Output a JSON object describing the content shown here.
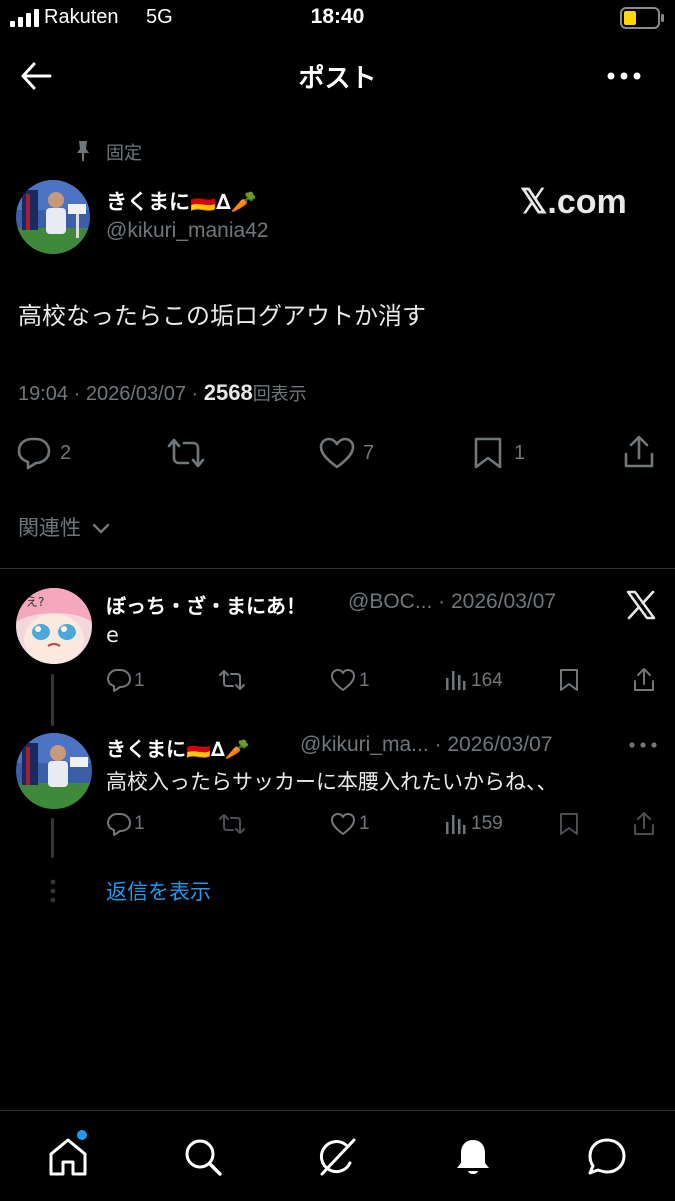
{
  "status_bar": {
    "carrier": "Rakuten",
    "network": "5G",
    "time": "18:40"
  },
  "header": {
    "title": "ポスト",
    "back_icon": "back-arrow-icon",
    "more_icon": "more-icon"
  },
  "post": {
    "pinned_label": "固定",
    "author_name": "きくまに🇩🇪∆🥕",
    "author_handle": "@kikuri_mania42",
    "brand": "𝕏.com",
    "text": "高校なったらこの垢ログアウトか消す",
    "time": "19:04",
    "date": "2026/03/07",
    "views_count": "2568",
    "views_label": "回表示",
    "replies": "2",
    "likes": "7",
    "bookmarks": "1"
  },
  "related_label": "関連性",
  "replies": [
    {
      "name": "ぼっち・ざ・まにあ！",
      "handle": "@BOC...",
      "date": "2026/03/07",
      "text": "e",
      "reply_count": "1",
      "like_count": "1",
      "views": "164"
    },
    {
      "name": "きくまに🇩🇪∆🥕",
      "handle": "@kikuri_ma...",
      "date": "2026/03/07",
      "text": "高校入ったらサッカーに本腰入れたいからね、、",
      "reply_count": "1",
      "like_count": "1",
      "views": "159"
    }
  ],
  "show_replies_label": "返信を表示",
  "colors": {
    "background": "#000000",
    "accent": "#1d9bf0",
    "muted": "#71767b",
    "text": "#e7e9ea"
  }
}
